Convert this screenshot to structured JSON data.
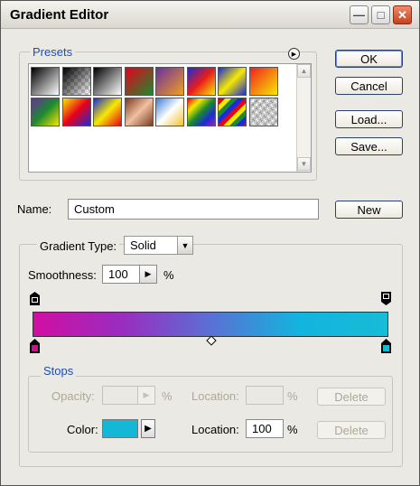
{
  "window": {
    "title": "Gradient Editor",
    "min_icon": "minimize-icon",
    "max_icon": "maximize-icon",
    "close_icon": "close-icon"
  },
  "presets": {
    "label": "Presets",
    "menu_icon": "flyout-menu-icon",
    "swatches": [
      "linear-gradient(135deg,#000,#fff)",
      "linear-gradient(135deg,#000 0%,rgba(255,255,255,0) 100%), repeating-conic-gradient(#ccc 0% 25%, #fff 0% 50%) 0 0/8px 8px",
      "linear-gradient(135deg,#000,#fff)",
      "linear-gradient(135deg,#e8001c,#1c8a2e)",
      "linear-gradient(135deg,#6a2ea0,#f0a020)",
      "linear-gradient(135deg,#1a2cd6,#e81c1c,#f6e800)",
      "linear-gradient(135deg,#1a2cd6,#f6e800,#1a2cd6)",
      "linear-gradient(135deg,#f02020,#f6e800)",
      "linear-gradient(135deg,#6a2ea0,#1c8a2e,#f6e800)",
      "linear-gradient(135deg,#f6e800,#e8001c,#1a2cd6)",
      "linear-gradient(135deg,#1a2cd6,#f6e800,#e8001c)",
      "linear-gradient(135deg,#7a3a22,#f0c0a0,#7a3a22)",
      "linear-gradient(135deg,#3a7cd6,#ffffff,#f0c030)",
      "linear-gradient(135deg,#e8001c,#f6e800,#1c8a2e,#1a2cd6,#a020c0)",
      "repeating-linear-gradient(135deg,#e8001c 0 5px,#f6e800 5px 10px,#1c8a2e 10px 15px,#1a2cd6 15px 20px)",
      "repeating-linear-gradient(135deg,rgba(0,0,0,0.25) 0 3px,rgba(255,255,255,0) 3px 6px), repeating-conic-gradient(#ccc 0% 25%, #fff 0% 50%) 0 0/8px 8px"
    ]
  },
  "buttons": {
    "ok": "OK",
    "cancel": "Cancel",
    "load": "Load...",
    "save": "Save...",
    "new": "New"
  },
  "name": {
    "label": "Name:",
    "value": "Custom"
  },
  "gradient": {
    "type_label": "Gradient Type:",
    "type_value": "Solid",
    "smoothness_label": "Smoothness:",
    "smoothness_value": "100",
    "smoothness_unit": "%",
    "colors": [
      "#d10fa2",
      "#9a2cc0",
      "#5a70d4",
      "#13b4de",
      "#17bcd6"
    ],
    "stop_colors": {
      "left": "#c8158f",
      "right": "#17b8d4"
    }
  },
  "stops": {
    "label": "Stops",
    "opacity_label": "Opacity:",
    "opacity_value": "",
    "opacity_unit": "%",
    "location1_label": "Location:",
    "location1_value": "",
    "location1_unit": "%",
    "delete1": "Delete",
    "color_label": "Color:",
    "color_value": "#12b8d5",
    "location2_label": "Location:",
    "location2_value": "100",
    "location2_unit": "%",
    "delete2": "Delete"
  }
}
